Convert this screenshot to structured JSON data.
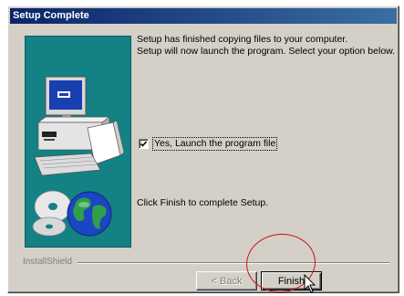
{
  "window": {
    "title": "Setup Complete"
  },
  "message": {
    "line1": "Setup has finished copying files to your computer.",
    "line2": "Setup will now launch the program. Select your option below."
  },
  "launch_option": {
    "label": "Yes, Launch the program file",
    "checked": true
  },
  "finish_text": "Click Finish to complete Setup.",
  "brand": "InstallShield",
  "buttons": {
    "back_label": "< Back",
    "finish_label": "Finish"
  },
  "annotation": {
    "highlight_color": "#d01010"
  },
  "colors": {
    "title_bar": "#0a246a",
    "panel": "#148184",
    "dialog_face": "#d4d0c8"
  },
  "icons": [
    "computer-icon",
    "globe-cd-icon",
    "checkmark-icon",
    "mouse-pointer-icon"
  ]
}
